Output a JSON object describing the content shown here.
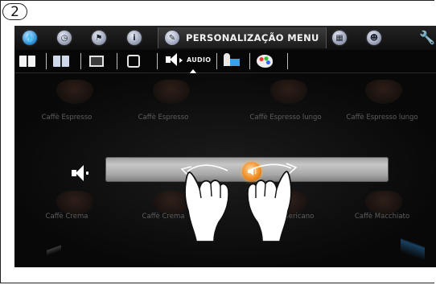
{
  "step": {
    "number": "2"
  },
  "topbar": {
    "active_tab": {
      "title": "PERSONALIZAÇÃO MENU",
      "icon": "pencil-icon"
    },
    "icons": [
      "drop-icon",
      "clock-icon",
      "flag-icon",
      "info-icon",
      "calendar-icon",
      "user-icon",
      "wrench-icon"
    ]
  },
  "subbar": {
    "items": [
      "book-icon",
      "book-blue-icon",
      "picture-icon",
      "timer-icon",
      "audio-icon",
      "user-picture-icon",
      "palette-icon"
    ],
    "active": {
      "label": "AUDIO"
    }
  },
  "products": {
    "row1": [
      "Caffè Espresso",
      "Caffè Espresso",
      "Caffè Espresso lungo",
      "Caffè Espresso lungo"
    ],
    "row2": [
      "Caffè Crema",
      "Caffè Crema",
      "Caffè Americano",
      "Caffè Macchiato"
    ]
  },
  "volume": {
    "level": 0.5,
    "thumb_icon": "speaker-icon"
  },
  "colors": {
    "accent": "#f08a1e",
    "background": "#0c0c0c",
    "slider": "#b0b0b0"
  },
  "gesture": {
    "type": "pinch-out",
    "icon": "two-hands-gesture-icon"
  }
}
